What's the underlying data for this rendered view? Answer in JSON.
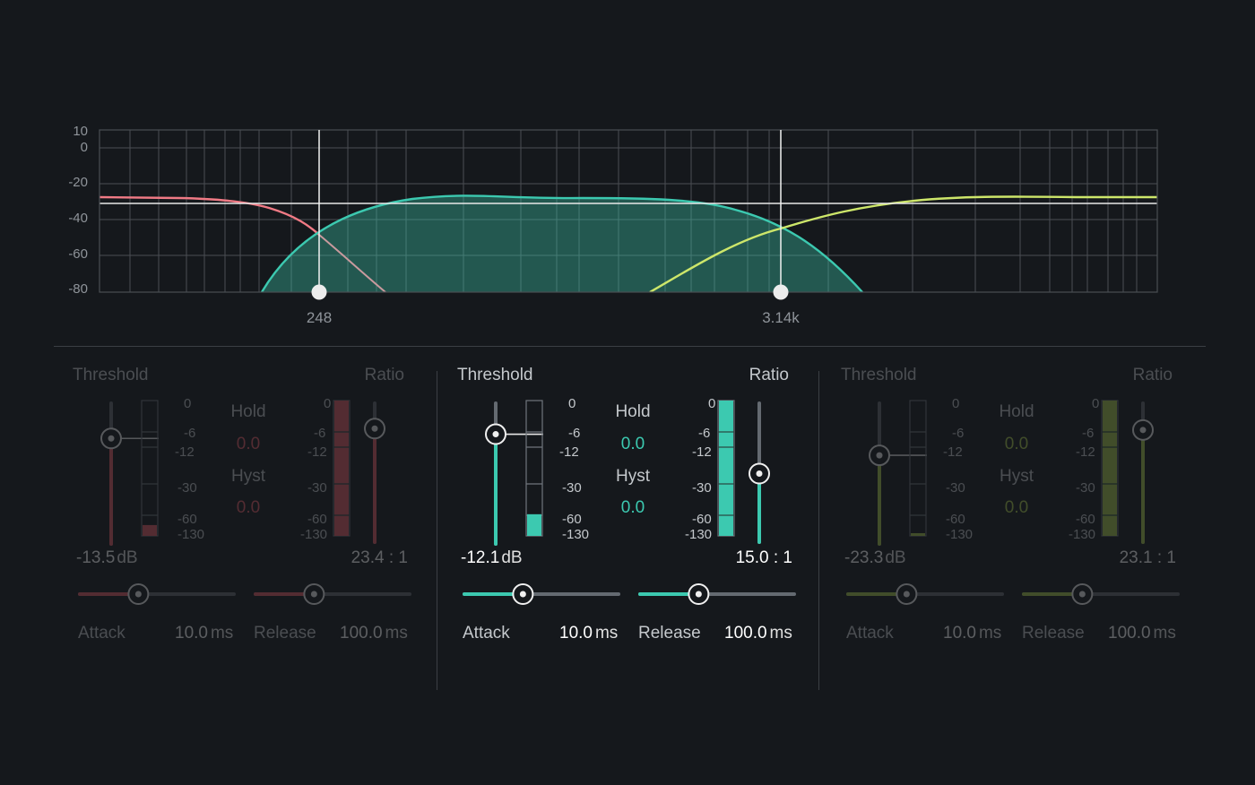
{
  "graph": {
    "db_ticks": [
      "10",
      "0",
      "-20",
      "-40",
      "-60",
      "-80"
    ],
    "crossovers": [
      "248",
      "3.14k"
    ],
    "colors": {
      "low": "#f07a85",
      "mid": "#3cc9b0",
      "high": "#cde66a",
      "grid": "#4a4e53"
    }
  },
  "meter_ticks": [
    "0",
    "-6",
    "-12",
    "-30",
    "-60",
    "-130"
  ],
  "bands": [
    {
      "threshold_label": "Threshold",
      "ratio_label": "Ratio",
      "hold_label": "Hold",
      "hold_value": "0.0",
      "hyst_label": "Hyst",
      "hyst_value": "0.0",
      "threshold_value": "-13.5",
      "threshold_unit": "dB",
      "ratio_value": "23.4 : 1",
      "attack_label": "Attack",
      "attack_value": "10.0",
      "attack_unit": "ms",
      "release_label": "Release",
      "release_value": "100.0",
      "release_unit": "ms",
      "color": "#e35a66",
      "active": false,
      "threshold_level": 0.75,
      "ratio_level": 0.82,
      "input_meter_level": 0.08,
      "gr_meter_level": 1.0,
      "attack_level": 0.38,
      "release_level": 0.38
    },
    {
      "threshold_label": "Threshold",
      "ratio_label": "Ratio",
      "hold_label": "Hold",
      "hold_value": "0.0",
      "hyst_label": "Hyst",
      "hyst_value": "0.0",
      "threshold_value": "-12.1",
      "threshold_unit": "dB",
      "ratio_value": "15.0 : 1",
      "attack_label": "Attack",
      "attack_value": "10.0",
      "attack_unit": "ms",
      "release_label": "Release",
      "release_value": "100.0",
      "release_unit": "ms",
      "color": "#3cc9b0",
      "active": true,
      "threshold_level": 0.78,
      "ratio_level": 0.5,
      "input_meter_level": 0.16,
      "gr_meter_level": 1.0,
      "attack_level": 0.38,
      "release_level": 0.38
    },
    {
      "threshold_label": "Threshold",
      "ratio_label": "Ratio",
      "hold_label": "Hold",
      "hold_value": "0.0",
      "hyst_label": "Hyst",
      "hyst_value": "0.0",
      "threshold_value": "-23.3",
      "threshold_unit": "dB",
      "ratio_value": "23.1 : 1",
      "attack_label": "Attack",
      "attack_value": "10.0",
      "attack_unit": "ms",
      "release_label": "Release",
      "release_value": "100.0",
      "release_unit": "ms",
      "color": "#a8c84a",
      "active": false,
      "threshold_level": 0.63,
      "ratio_level": 0.81,
      "input_meter_level": 0.02,
      "gr_meter_level": 1.0,
      "attack_level": 0.38,
      "release_level": 0.38
    }
  ]
}
